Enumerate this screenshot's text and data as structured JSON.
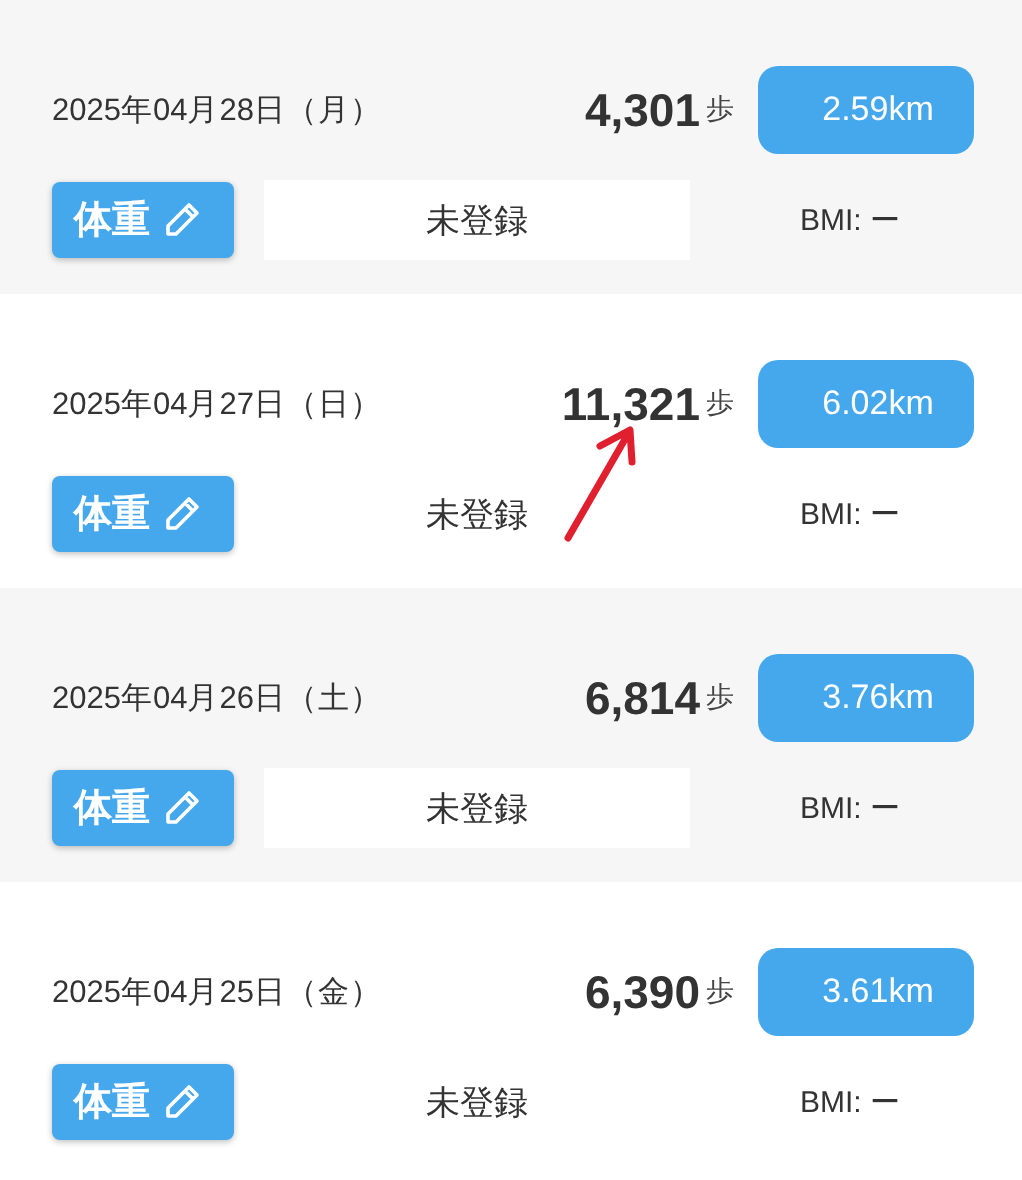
{
  "days": [
    {
      "date": "2025年04月28日（月）",
      "steps": "4,301",
      "steps_unit": "歩",
      "distance": "2.59km",
      "weight_button": "体重",
      "weight": "未登録",
      "bmi": "BMI: ー",
      "shaded": true,
      "annotated": false
    },
    {
      "date": "2025年04月27日（日）",
      "steps": "11,321",
      "steps_unit": "歩",
      "distance": "6.02km",
      "weight_button": "体重",
      "weight": "未登録",
      "bmi": "BMI: ー",
      "shaded": false,
      "annotated": true
    },
    {
      "date": "2025年04月26日（土）",
      "steps": "6,814",
      "steps_unit": "歩",
      "distance": "3.76km",
      "weight_button": "体重",
      "weight": "未登録",
      "bmi": "BMI: ー",
      "shaded": true,
      "annotated": false
    },
    {
      "date": "2025年04月25日（金）",
      "steps": "6,390",
      "steps_unit": "歩",
      "distance": "3.61km",
      "weight_button": "体重",
      "weight": "未登録",
      "bmi": "BMI: ー",
      "shaded": false,
      "annotated": false
    }
  ]
}
